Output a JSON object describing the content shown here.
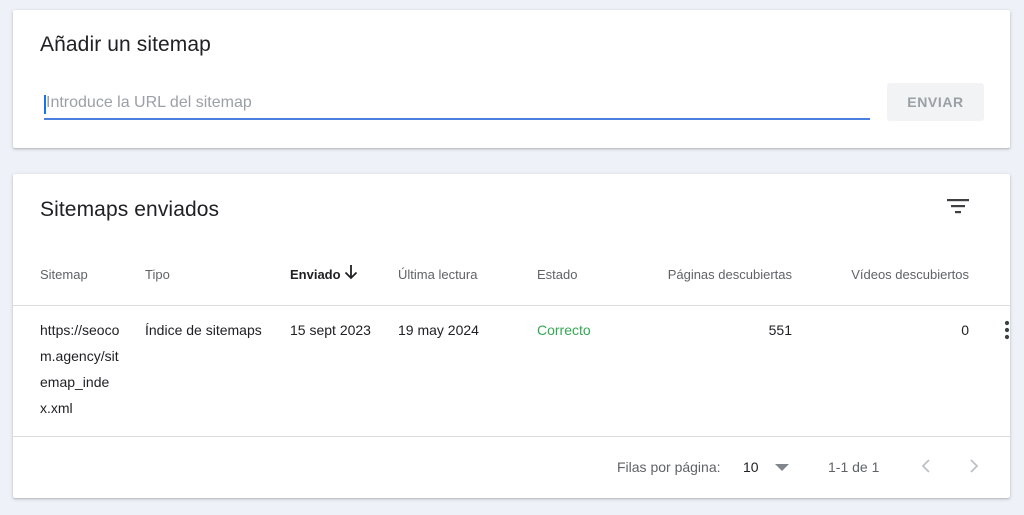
{
  "add_sitemap": {
    "title": "Añadir un sitemap",
    "input_placeholder": "Introduce la URL del sitemap",
    "input_value": "",
    "submit_label": "ENVIAR"
  },
  "sitemaps": {
    "title": "Sitemaps enviados",
    "filter_icon": "filter-list-icon",
    "columns": [
      "Sitemap",
      "Tipo",
      "Enviado",
      "Última lectura",
      "Estado",
      "Páginas descubiertas",
      "Vídeos descubiertos"
    ],
    "sorted_column": "Enviado",
    "sort_direction": "descending",
    "rows": [
      {
        "sitemap": "https://seocom.agency/sitemap_index.xml",
        "tipo": "Índice de sitemaps",
        "enviado": "15 sept 2023",
        "ultima_lectura": "19 may 2024",
        "estado": "Correcto",
        "paginas": "551",
        "videos": "0"
      }
    ],
    "pagination": {
      "rows_per_page_label": "Filas por página:",
      "rows_per_page": "10",
      "range": "1-1 de 1"
    }
  },
  "colors": {
    "accent": "#4a7fe0",
    "status_ok": "#34a853",
    "background": "#eef1f8"
  }
}
